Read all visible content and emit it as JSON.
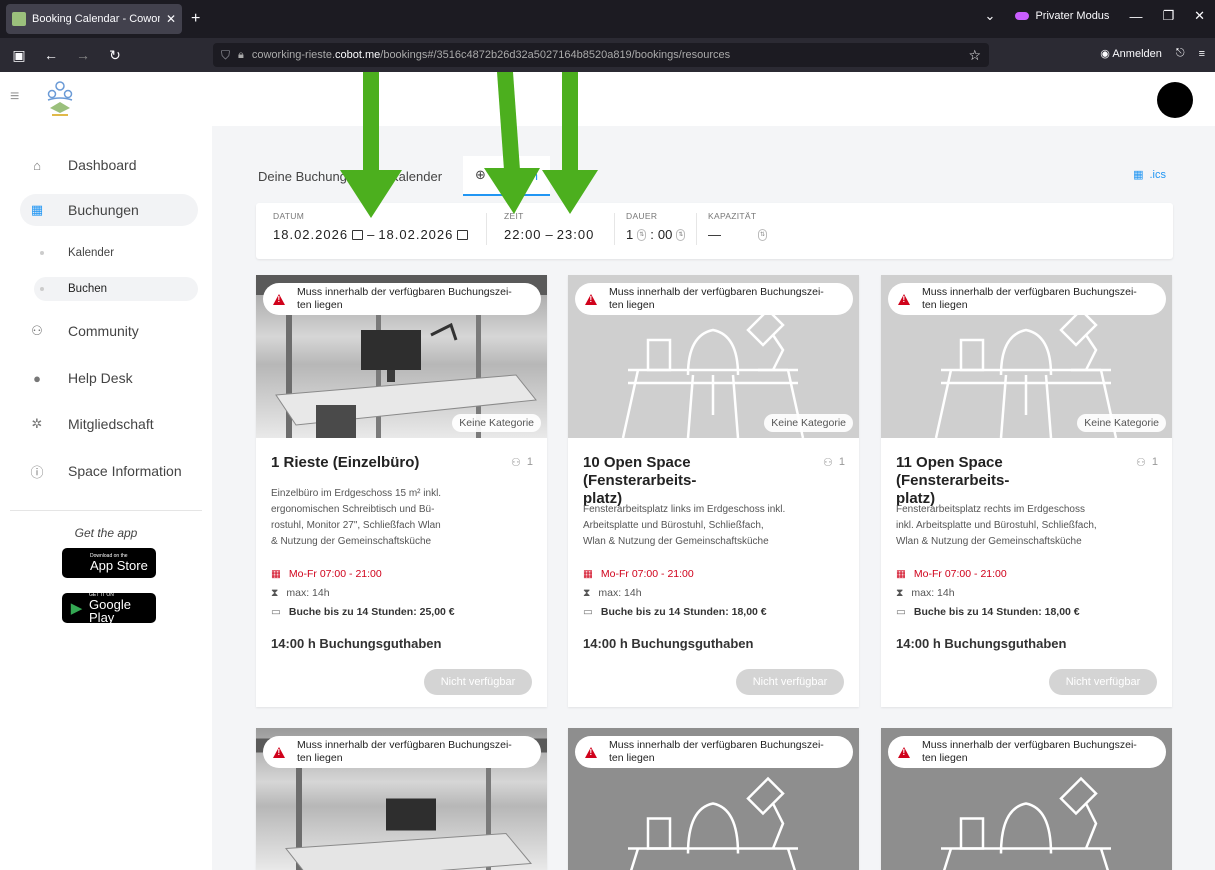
{
  "browser": {
    "tab_title": "Booking Calendar - Coworking",
    "private_mode": "Privater Modus",
    "url_prefix": "coworking-rieste.",
    "url_host": "cobot.me",
    "url_path": "/bookings#/3516c4872b26d32a5027164b8520a819/bookings/resources",
    "signin": "Anmelden"
  },
  "sidebar": {
    "items": [
      {
        "label": "Dashboard",
        "icon": "home-icon"
      },
      {
        "label": "Buchungen",
        "icon": "calendar-icon"
      },
      {
        "label": "Community",
        "icon": "people-icon"
      },
      {
        "label": "Help Desk",
        "icon": "chat-icon"
      },
      {
        "label": "Mitgliedschaft",
        "icon": "gear-icon"
      },
      {
        "label": "Space Information",
        "icon": "info-icon"
      }
    ],
    "sub_items": [
      {
        "label": "Kalender"
      },
      {
        "label": "Buchen"
      }
    ],
    "get_app": "Get the app",
    "app_store_small": "Download on the",
    "app_store_big": "App Store",
    "google_play_small": "GET IT ON",
    "google_play_big": "Google Play"
  },
  "tabs": {
    "tab1": "Deine Buchungen",
    "tab2": "Kalender",
    "tab3": "Buchen",
    "ics": ".ics"
  },
  "filters": {
    "datum_label": "DATUM",
    "date_from": "18.02.2026",
    "date_to": "18.02.2026",
    "zeit_label": "ZEIT",
    "time_from": "22:00",
    "time_to": "23:00",
    "dauer_label": "DAUER",
    "dauer_h": "1",
    "dauer_m": "00",
    "kapazitaet_label": "KAPAZITÄT",
    "kapazitaet_value": "—"
  },
  "warning_text": "Muss innerhalb der verfügbaren Buchungszei-ten liegen",
  "warning_line1": "Muss innerhalb der verfügbaren Buchungszei-",
  "warning_line2": "ten liegen",
  "category": "Keine Kategorie",
  "cards": [
    {
      "title": "1 Rieste (Einzelbüro)",
      "capacity": "1",
      "desc_lines": [
        "Einzelbüro im Erdgeschoss 15 m² inkl.",
        "ergonomischen Schreibtisch und Bü-",
        "rostuhl, Monitor 27\", Schließfach Wlan",
        "& Nutzung der Gemeinschaftsküche"
      ],
      "hours": "Mo-Fr 07:00 - 21:00",
      "max": "max: 14h",
      "price": "Buche bis zu 14 Stunden: 25,00 €",
      "credit": "14:00 h Buchungsguthaben",
      "button": "Nicht verfügbar"
    },
    {
      "title_line1": "10 Open Space (Fensterarbeits-",
      "title_line2": "platz)",
      "capacity": "1",
      "desc_lines": [
        "Fensterarbeitsplatz links im Erdgeschoss inkl.",
        "Arbeitsplatte und Bürostuhl, Schließfach,",
        "Wlan & Nutzung der Gemeinschaftsküche"
      ],
      "hours": "Mo-Fr 07:00 - 21:00",
      "max": "max: 14h",
      "price": "Buche bis zu 14 Stunden: 18,00 €",
      "credit": "14:00 h Buchungsguthaben",
      "button": "Nicht verfügbar"
    },
    {
      "title_line1": "11 Open Space (Fensterarbeits-",
      "title_line2": "platz)",
      "capacity": "1",
      "desc_lines": [
        "Fensterarbeitsplatz rechts im Erdgeschoss",
        "inkl. Arbeitsplatte und Bürostuhl, Schließfach,",
        "Wlan & Nutzung der Gemeinschaftsküche"
      ],
      "hours": "Mo-Fr 07:00 - 21:00",
      "max": "max: 14h",
      "price": "Buche bis zu 14 Stunden: 18,00 €",
      "credit": "14:00 h Buchungsguthaben",
      "button": "Nicht verfügbar"
    }
  ],
  "colors": {
    "accent": "#2196f3",
    "warning": "#d0021b",
    "annotation_arrow": "#4caf1e"
  }
}
